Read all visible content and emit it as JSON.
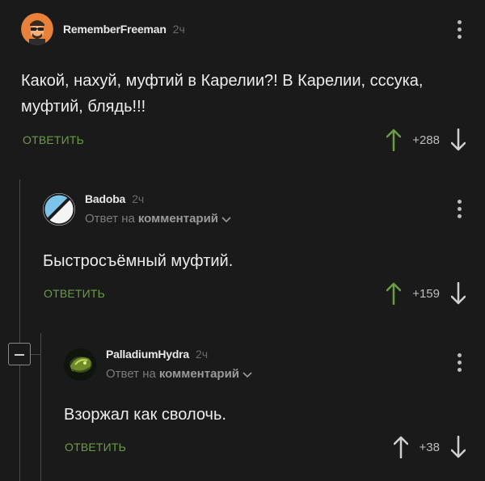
{
  "comments": [
    {
      "author": "RememberFreeman",
      "time": "2ч",
      "text": "Какой, нахуй, муфтий в Карелии?! В Карелии, сссука, муфтий, блядь!!!",
      "reply_label": "ОТВЕТИТЬ",
      "score": "+288",
      "upvote_color": "#6a9d44"
    },
    {
      "author": "Badoba",
      "time": "2ч",
      "reply_prefix": "Ответ на",
      "reply_target": "комментарий",
      "text": "Быстросъёмный муфтий.",
      "reply_label": "ОТВЕТИТЬ",
      "score": "+159",
      "upvote_color": "#6a9d44"
    },
    {
      "author": "PalladiumHydra",
      "time": "2ч",
      "reply_prefix": "Ответ на",
      "reply_target": "комментарий",
      "text": "Взоржал как сволочь.",
      "reply_label": "ОТВЕТИТЬ",
      "score": "+38",
      "upvote_color": "#cfcfcf"
    }
  ],
  "icons": {
    "upvote": "arrow-up-icon",
    "downvote": "arrow-down-icon",
    "more": "more-vertical-icon",
    "chevron": "chevron-down-icon",
    "collapse": "minus-icon"
  }
}
